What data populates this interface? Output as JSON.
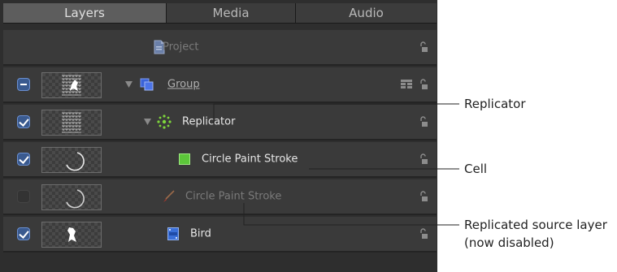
{
  "tabs": [
    {
      "label": "Layers",
      "active": true
    },
    {
      "label": "Media",
      "active": false
    },
    {
      "label": "Audio",
      "active": false
    }
  ],
  "rows": [
    {
      "label": "Project",
      "checkbox": "none",
      "icon": "project-document-icon",
      "thumbnail": "none",
      "state": "dim"
    },
    {
      "label": "Group",
      "checkbox": "mixed",
      "icon": "group-layers-icon",
      "thumbnail": "birds-pattern",
      "state": "normal",
      "expanded": true
    },
    {
      "label": "Replicator",
      "checkbox": "checked",
      "icon": "replicator-icon",
      "thumbnail": "birds-pattern",
      "state": "normal",
      "expanded": true
    },
    {
      "label": "Circle Paint Stroke",
      "checkbox": "none",
      "icon": "green-cell-icon",
      "thumbnail": "circle-stroke",
      "state": "normal"
    },
    {
      "label": "Circle Paint Stroke",
      "checkbox": "unchecked",
      "icon": "paint-brush-icon",
      "thumbnail": "circle-stroke",
      "state": "disabled"
    },
    {
      "label": "Bird",
      "checkbox": "checked",
      "icon": "image-layer-icon",
      "thumbnail": "bird",
      "state": "normal"
    }
  ],
  "annotations": {
    "replicator": "Replicator",
    "cell": "Cell",
    "source_line1": "Replicated source layer",
    "source_line2": "(now disabled)"
  },
  "colors": {
    "panel_bg": "#2e2e2e",
    "row_bg": "#3a3a3a",
    "checkbox_blue": "#3a5a8f",
    "cell_green": "#5cc63a",
    "replicator_green": "#7ed63c"
  }
}
